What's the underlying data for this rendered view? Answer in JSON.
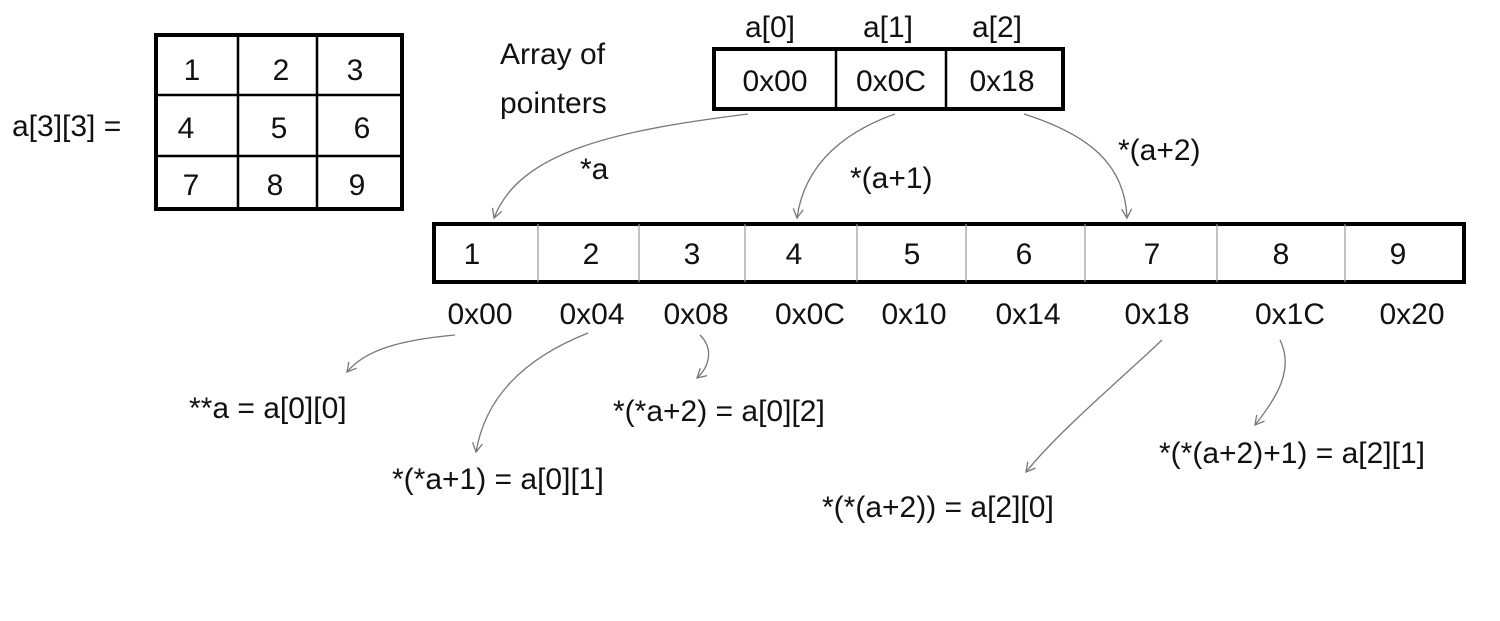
{
  "matrix": {
    "label": "a[3][3] =",
    "rows": [
      [
        "1",
        "2",
        "3"
      ],
      [
        "4",
        "5",
        "6"
      ],
      [
        "7",
        "8",
        "9"
      ]
    ]
  },
  "pointer_array": {
    "caption_line1": "Array of",
    "caption_line2": "pointers",
    "headers": [
      "a[0]",
      "a[1]",
      "a[2]"
    ],
    "values": [
      "0x00",
      "0x0C",
      "0x18"
    ]
  },
  "deref_labels": [
    "*a",
    "*(a+1)",
    "*(a+2)"
  ],
  "memory": {
    "cells": [
      "1",
      "2",
      "3",
      "4",
      "5",
      "6",
      "7",
      "8",
      "9"
    ],
    "addresses": [
      "0x00",
      "0x04",
      "0x08",
      "0x0C",
      "0x10",
      "0x14",
      "0x18",
      "0x1C",
      "0x20"
    ]
  },
  "expressions": [
    "**a = a[0][0]",
    "*(*a+1) = a[0][1]",
    "*(*a+2) = a[0][2]",
    "*(*(a+2)) = a[2][0]",
    "*(*(a+2)+1) = a[2][1]"
  ]
}
